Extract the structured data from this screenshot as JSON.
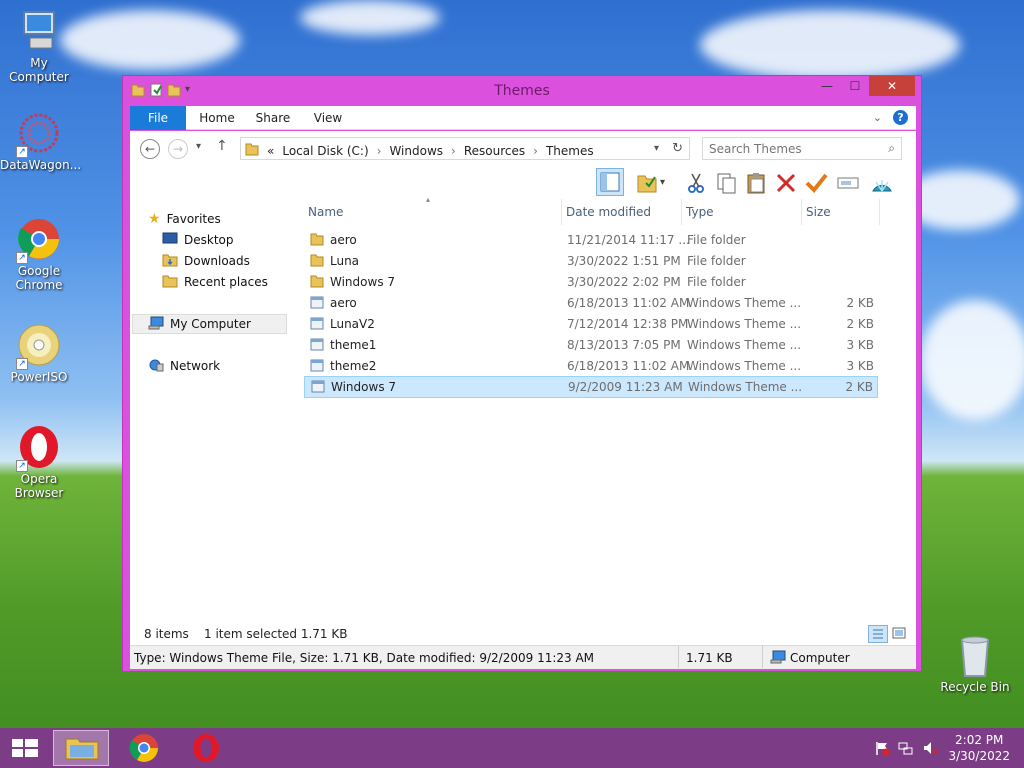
{
  "desktop": {
    "icons": [
      {
        "label": "My Computer"
      },
      {
        "label": "DataWagon..."
      },
      {
        "label": "Google Chrome"
      },
      {
        "label": "PowerISO"
      },
      {
        "label": "Opera Browser"
      },
      {
        "label": "Recycle Bin"
      }
    ]
  },
  "window": {
    "title": "Themes",
    "ribbon_tabs": [
      "File",
      "Home",
      "Share",
      "View"
    ],
    "address": {
      "prefix": "«",
      "crumbs": [
        "Local Disk (C:)",
        "Windows",
        "Resources",
        "Themes"
      ]
    },
    "search": {
      "placeholder": "Search Themes"
    },
    "nav": {
      "favorites": "Favorites",
      "desktop": "Desktop",
      "downloads": "Downloads",
      "recent": "Recent places",
      "computer": "My Computer",
      "network": "Network"
    },
    "columns": {
      "name": "Name",
      "date": "Date modified",
      "type": "Type",
      "size": "Size"
    },
    "files": [
      {
        "name": "aero",
        "date": "11/21/2014 11:17 ...",
        "type": "File folder",
        "size": "",
        "kind": "folder"
      },
      {
        "name": "Luna",
        "date": "3/30/2022 1:51 PM",
        "type": "File folder",
        "size": "",
        "kind": "folder"
      },
      {
        "name": "Windows 7",
        "date": "3/30/2022 2:02 PM",
        "type": "File folder",
        "size": "",
        "kind": "folder"
      },
      {
        "name": "aero",
        "date": "6/18/2013 11:02 AM",
        "type": "Windows Theme ...",
        "size": "2 KB",
        "kind": "theme"
      },
      {
        "name": "LunaV2",
        "date": "7/12/2014 12:38 PM",
        "type": "Windows Theme ...",
        "size": "2 KB",
        "kind": "theme"
      },
      {
        "name": "theme1",
        "date": "8/13/2013 7:05 PM",
        "type": "Windows Theme ...",
        "size": "3 KB",
        "kind": "theme"
      },
      {
        "name": "theme2",
        "date": "6/18/2013 11:02 AM",
        "type": "Windows Theme ...",
        "size": "3 KB",
        "kind": "theme"
      },
      {
        "name": "Windows 7",
        "date": "9/2/2009 11:23 AM",
        "type": "Windows Theme ...",
        "size": "2 KB",
        "kind": "theme",
        "selected": true
      }
    ],
    "status": {
      "items": "8 items",
      "selected": "1 item selected  1.71 KB"
    },
    "details": {
      "text": "Type: Windows Theme File, Size: 1.71 KB, Date modified: 9/2/2009 11:23 AM",
      "size": "1.71 KB",
      "location": "Computer"
    }
  },
  "taskbar": {
    "time": "2:02 PM",
    "date": "3/30/2022"
  },
  "colors": {
    "window_frame": "#dc50de",
    "file_tab": "#1a7bd8",
    "selection": "#cce8ff",
    "taskbar": "#7d3d86"
  }
}
